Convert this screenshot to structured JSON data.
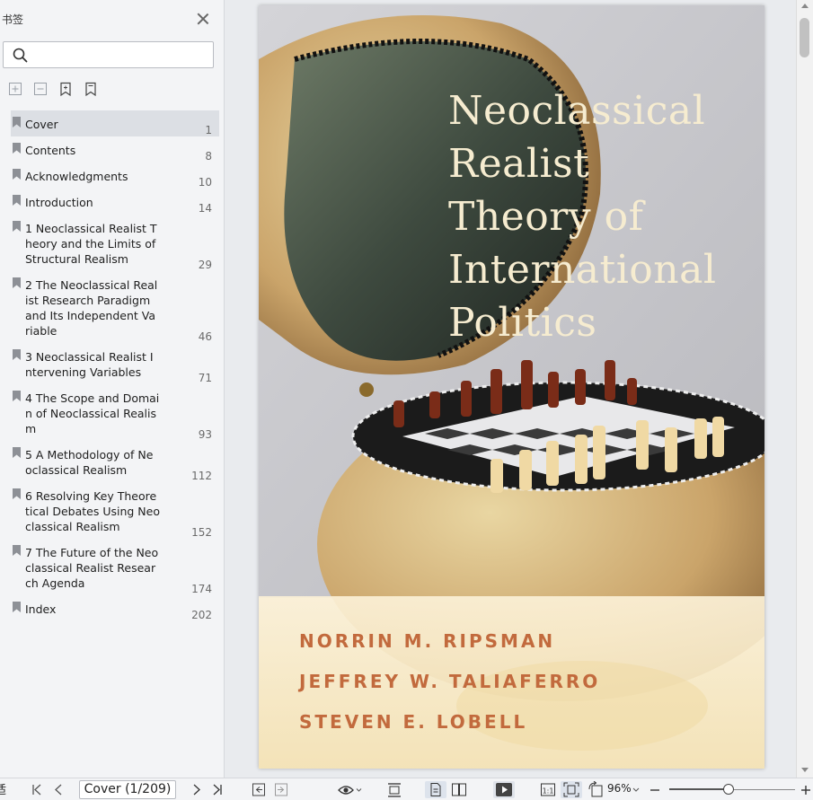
{
  "sidebar": {
    "title": "书签",
    "search_placeholder": "",
    "bookmarks": [
      {
        "label": "Cover",
        "page": "1",
        "selected": true
      },
      {
        "label": "Contents",
        "page": "8"
      },
      {
        "label": "Acknowledgments",
        "page": "10"
      },
      {
        "label": "Introduction",
        "page": "14"
      },
      {
        "label": "1 Neoclassical Realist Theory and the Limits of Structural Realism",
        "page": "29"
      },
      {
        "label": "2 The Neoclassical Realist Research Paradigm and Its Independent Variable",
        "page": "46"
      },
      {
        "label": "3 Neoclassical Realist Intervening Variables",
        "page": "71"
      },
      {
        "label": "4 The Scope and Domain of Neoclassical Realism",
        "page": "93"
      },
      {
        "label": "5 A Methodology of Neoclassical Realism",
        "page": "112"
      },
      {
        "label": "6 Resolving Key Theoretical Debates Using Neoclassical Realism",
        "page": "152"
      },
      {
        "label": "7 The Future of the Neoclassical Realist Research Agenda",
        "page": "174"
      },
      {
        "label": "Index",
        "page": "202"
      }
    ]
  },
  "cover": {
    "title": "Neoclassical\nRealist\nTheory of\nInternational\nPolitics",
    "authors": [
      "NORRIN M. RIPSMAN",
      "JEFFREY W. TALIAFERRO",
      "STEVEN E. LOBELL"
    ]
  },
  "toolbar": {
    "left_fragment": "适",
    "page_indicator": "Cover (1/209)",
    "zoom": "96%",
    "zoom_fraction": 0.47
  },
  "colors": {
    "title": "#f6ecd0",
    "authors": "#c26a3d",
    "selected_row": "#dcdfe4"
  }
}
